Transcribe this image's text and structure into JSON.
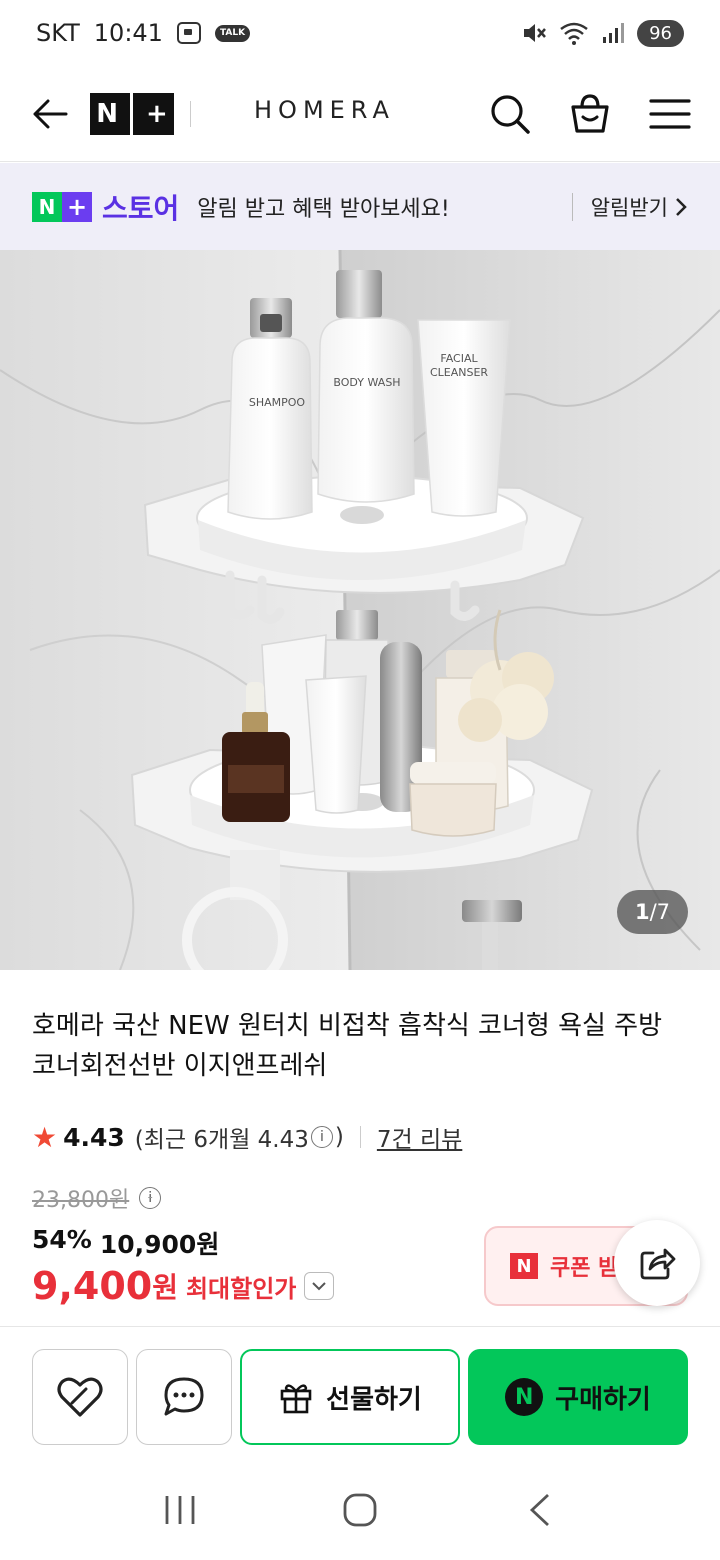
{
  "status_bar": {
    "carrier": "SKT",
    "time": "10:41",
    "talk_label": "TALK",
    "battery": "96"
  },
  "header": {
    "logo_n": "N",
    "logo_plus": "+",
    "brand": "HOMERA"
  },
  "store_banner": {
    "badge_n": "N",
    "badge_plus": "+",
    "store_name": "스토어",
    "message": "알림 받고 혜택 받아보세요!",
    "cta": "알림받기"
  },
  "hero": {
    "pager_current": "1",
    "pager_total": "/7",
    "labels": {
      "shampoo": "SHAMPOO",
      "body_wash": "BODY WASH",
      "cleanser_line1": "FACIAL",
      "cleanser_line2": "CLEANSER"
    }
  },
  "product": {
    "title": "호메라 국산 NEW 원터치 비접착 흡착식 코너형 욕실 주방 코너회전선반 이지앤프레쉬",
    "rating": "4.43",
    "rating_detail_prefix": "(최근 6개월 4.43",
    "rating_detail_suffix": ")",
    "reviews": "7건 리뷰",
    "original_price": "23,800원",
    "discount": "54%",
    "sale_price": "10,900원",
    "max_price_number": "9,400",
    "max_price_unit": "원",
    "max_price_label": "최대할인가"
  },
  "coupon": {
    "badge": "N",
    "label": "쿠폰 받"
  },
  "actions": {
    "gift": "선물하기",
    "buy_badge": "N",
    "buy": "구매하기"
  },
  "colors": {
    "naver_green": "#03c75a",
    "store_purple": "#5a31e3",
    "sale_red": "#e8303a"
  },
  "icons": [
    "back-arrow-icon",
    "search-icon",
    "cart-icon",
    "menu-icon",
    "star-icon",
    "info-icon",
    "chevron-down-icon",
    "share-icon",
    "heart-icon",
    "chat-icon",
    "gift-icon"
  ]
}
